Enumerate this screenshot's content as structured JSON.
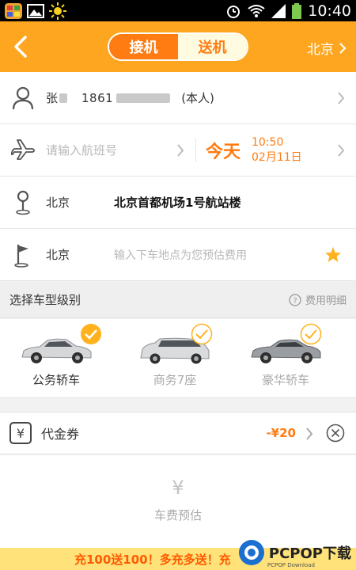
{
  "status_bar": {
    "time": "10:40"
  },
  "header": {
    "tab_pickup": "接机",
    "tab_dropoff": "送机",
    "city": "北京",
    "colors": {
      "header_bg": "#ffa620",
      "accent": "#ff7c12"
    }
  },
  "passenger": {
    "name": "张",
    "phone": "1861",
    "self_tag": "(本人)"
  },
  "flight": {
    "placeholder": "请输入航班号",
    "day": "今天",
    "time": "10:50",
    "date": "02月11日"
  },
  "pickup": {
    "city": "北京",
    "location": "北京首都机场1号航站楼"
  },
  "dropoff": {
    "city": "北京",
    "placeholder": "输入下车地点为您预估费用"
  },
  "car_section": {
    "title": "选择车型级别",
    "fee_detail": "费用明细"
  },
  "cars": [
    {
      "label": "公务轿车",
      "selected": true
    },
    {
      "label": "商务7座",
      "selected": false
    },
    {
      "label": "豪华轿车",
      "selected": false
    }
  ],
  "voucher": {
    "icon": "¥",
    "label": "代金券",
    "amount": "-¥20"
  },
  "estimate": {
    "icon": "¥",
    "label": "车费预估"
  },
  "banner": {
    "text": "充100送100！多充多送！充"
  },
  "watermark": {
    "text": "PCPOP下载",
    "sub": "PCPOP Download"
  }
}
